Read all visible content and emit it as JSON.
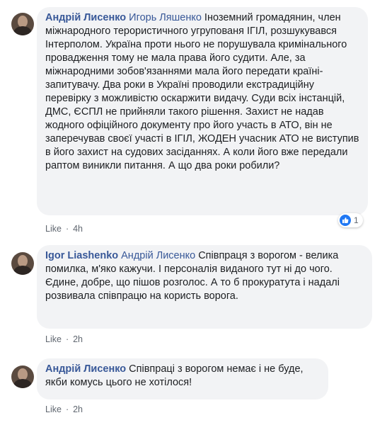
{
  "comments": [
    {
      "author": "Андрій Лисенко",
      "mention": "Игорь Ляшенко",
      "text": "Іноземний громадянин, член міжнародного терористичного угрупованя ІГІЛ, розшукувався Інтерполом. Україна проти нього не порушувала кримінального провадження тому не мала права його судити. Але, за міжнародними зобов'язаннями мала його передати країні-запитувачу. Два роки в Україні проводили екстрадиційну перевірку з можливістю оскаржити видачу. Суди всіх інстанцій, ДМС, ЄСПЛ не прийняли такого рішення. Захист не надав жодного офіційного документу про його участь в АТО, він не заперечував своєї участі в ІГІЛ, ЖОДЕН учасник АТО не виступив в його захист на судових засіданнях. А коли його вже передали раптом виникли питання. А що два роки робили?",
      "like_label": "Like",
      "time": "4h",
      "reaction_count": "1"
    },
    {
      "author": "Igor Liashenko",
      "mention": "Андрій Лисенко",
      "text": "Співпраця з ворогом - велика помилка, м'яко кажучи. І персоналія виданого тут ні до чого. Єдине, добре, що пішов розголос. А то б прокуратута і надалі розвивала співпрацю на користь ворога.",
      "like_label": "Like",
      "time": "2h"
    },
    {
      "author": "Андрій Лисенко",
      "text": "Співпраці з ворогом немає і не буде, якби комусь цього не хотілося!",
      "like_label": "Like",
      "time": "2h"
    }
  ],
  "separator": "·",
  "icons": {
    "reaction": "thumbs-up-icon",
    "avatar": "user-avatar"
  },
  "colors": {
    "author": "#385898",
    "bubble": "#f2f3f5",
    "meta": "#606770",
    "like_badge": "#2078f4"
  }
}
